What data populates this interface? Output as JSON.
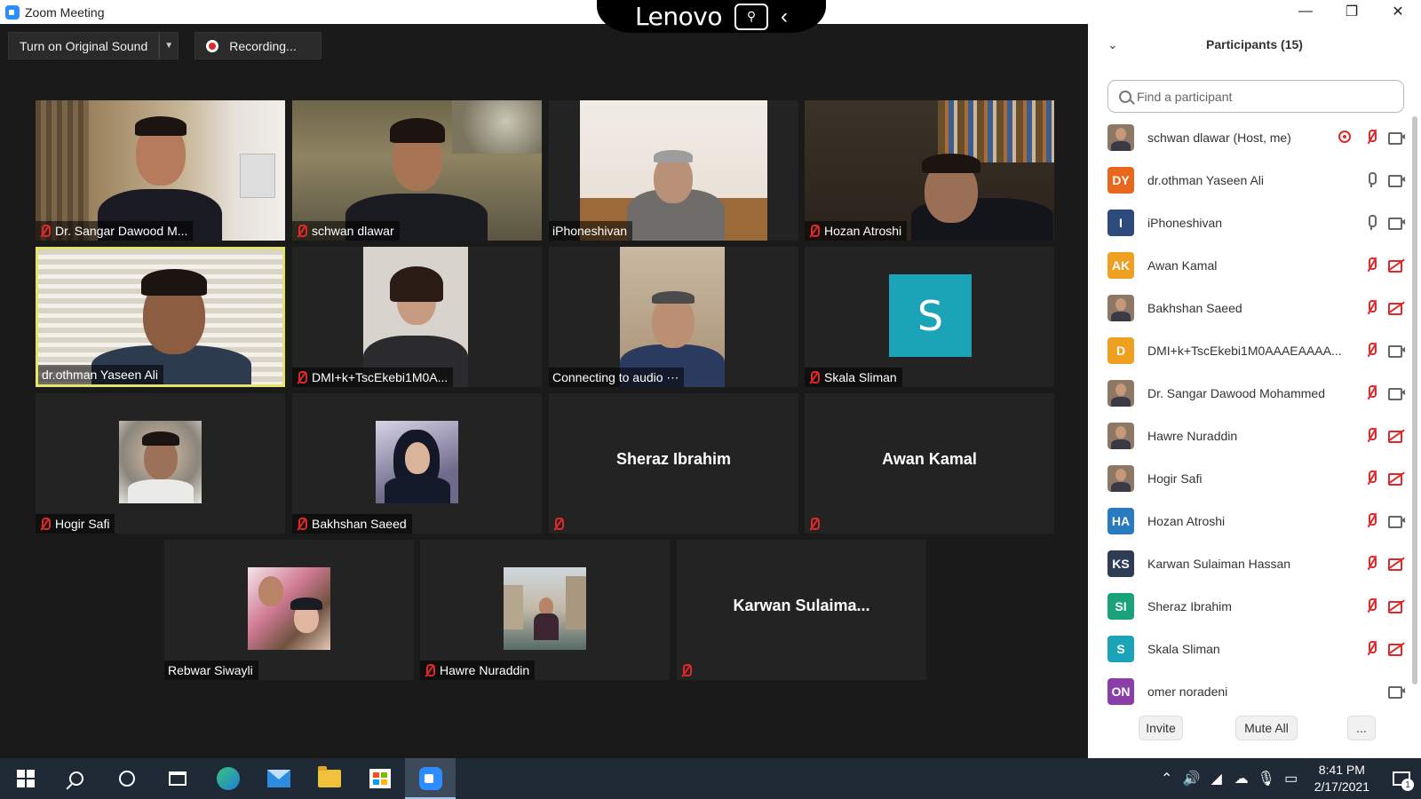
{
  "window": {
    "title": "Zoom Meeting",
    "overlay_brand": "Lenovo",
    "controls": [
      "minimize",
      "restore",
      "close"
    ]
  },
  "toolbar": {
    "original_sound_label": "Turn on Original Sound",
    "recording_label": "Recording..."
  },
  "video_tiles": [
    {
      "name": "Dr. Sangar Dawood M...",
      "muted": true,
      "video": true
    },
    {
      "name": "schwan dlawar",
      "muted": true,
      "video": true
    },
    {
      "name": "iPhoneshivan",
      "muted": false,
      "video": true
    },
    {
      "name": "Hozan Atroshi",
      "muted": true,
      "video": true
    },
    {
      "name": "dr.othman Yaseen Ali",
      "muted": false,
      "video": true,
      "active_speaker": true
    },
    {
      "name": "DMI+k+TscEkebi1M0A...",
      "muted": true,
      "video": true
    },
    {
      "name": "Connecting to audio ⋯",
      "muted": false,
      "video": true
    },
    {
      "name": "Skala Sliman",
      "muted": true,
      "video": false,
      "avatar_letter": "S",
      "avatar_color": "#1ba3b8"
    },
    {
      "name": "Hogir Safi",
      "muted": true,
      "video": false,
      "profile_photo": true
    },
    {
      "name": "Bakhshan Saeed",
      "muted": true,
      "video": false,
      "profile_photo": true
    },
    {
      "name": "",
      "center_name": "Sheraz Ibrahim",
      "muted": true,
      "video": false
    },
    {
      "name": "",
      "center_name": "Awan Kamal",
      "muted": true,
      "video": false
    },
    {
      "name": "Rebwar Siwayli",
      "muted": false,
      "video": false,
      "profile_photo": true
    },
    {
      "name": "Hawre Nuraddin",
      "muted": true,
      "video": false,
      "profile_photo": true
    },
    {
      "name": "",
      "center_name": "Karwan  Sulaima...",
      "muted": true,
      "video": false
    }
  ],
  "participants_panel": {
    "title": "Participants (15)",
    "search_placeholder": "Find a participant",
    "participants": [
      {
        "name": "schwan dlawar (Host, me)",
        "avatar": "photo",
        "recording": true,
        "mic": "off",
        "cam": "on"
      },
      {
        "name": "dr.othman Yaseen Ali",
        "avatar": "DY",
        "color": "#e8671c",
        "mic": "on",
        "cam": "on"
      },
      {
        "name": "iPhoneshivan",
        "avatar": "I",
        "color": "#2c4a7a",
        "mic": "on",
        "cam": "on"
      },
      {
        "name": "Awan Kamal",
        "avatar": "AK",
        "color": "#f0a020",
        "mic": "off",
        "cam": "off"
      },
      {
        "name": "Bakhshan Saeed",
        "avatar": "photo",
        "mic": "off",
        "cam": "off"
      },
      {
        "name": "DMI+k+TscEkebi1M0AAAEAAAA...",
        "avatar": "D",
        "color": "#f0a020",
        "mic": "off",
        "cam": "on"
      },
      {
        "name": "Dr. Sangar Dawood Mohammed",
        "avatar": "photo",
        "mic": "off",
        "cam": "on"
      },
      {
        "name": "Hawre Nuraddin",
        "avatar": "photo",
        "mic": "off",
        "cam": "off"
      },
      {
        "name": "Hogir Safi",
        "avatar": "photo",
        "mic": "off",
        "cam": "off"
      },
      {
        "name": "Hozan Atroshi",
        "avatar": "HA",
        "color": "#2a7ac0",
        "mic": "off",
        "cam": "on"
      },
      {
        "name": "Karwan Sulaiman Hassan",
        "avatar": "KS",
        "color": "#2e3d55",
        "mic": "off",
        "cam": "off"
      },
      {
        "name": "Sheraz Ibrahim",
        "avatar": "SI",
        "color": "#1aa37a",
        "mic": "off",
        "cam": "off"
      },
      {
        "name": "Skala Sliman",
        "avatar": "S",
        "color": "#1ba3b8",
        "mic": "off",
        "cam": "off"
      },
      {
        "name": "omer noradeni",
        "avatar": "ON",
        "color": "#8a3fa8",
        "mic": "none",
        "cam": "on"
      }
    ],
    "invite_label": "Invite",
    "mute_all_label": "Mute All",
    "more_label": "..."
  },
  "taskbar": {
    "time": "8:41 PM",
    "date": "2/17/2021",
    "notification_count": "1"
  }
}
